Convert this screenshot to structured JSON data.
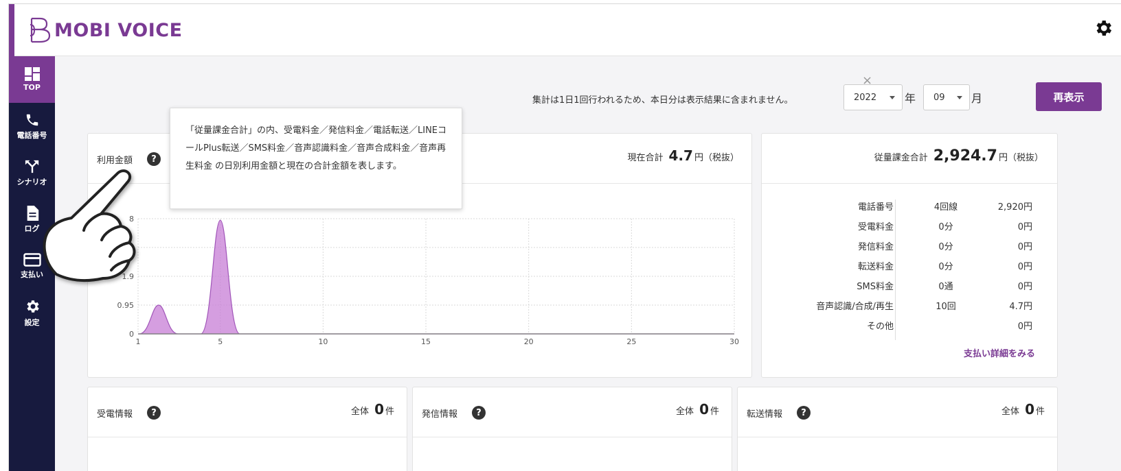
{
  "app": {
    "name": "MOBI VOICE"
  },
  "sidebar": {
    "items": [
      {
        "label": "TOP",
        "icon": "dashboard-icon",
        "active": true
      },
      {
        "label": "電話番号",
        "icon": "phone-icon"
      },
      {
        "label": "シナリオ",
        "icon": "scenario-branch-icon"
      },
      {
        "label": "ログ",
        "icon": "log-document-icon"
      },
      {
        "label": "支払い",
        "icon": "credit-card-icon"
      },
      {
        "label": "設定",
        "icon": "gear-icon"
      }
    ]
  },
  "header": {
    "close_glyph": "×",
    "notice": "集計は1日1回行われるため、本日分は表示結果に含まれません。",
    "year_value": "2022",
    "year_unit": "年",
    "month_value": "09",
    "month_unit": "月",
    "refresh_label": "再表示"
  },
  "usage_card": {
    "title": "利用金額",
    "help": "?",
    "total_label": "現在合計",
    "total_value": "4.7",
    "total_unit": "円（税抜）"
  },
  "tooltip": {
    "text": "「従量課金合計」の内、受電料金／発信料金／電話転送／LINEコールPlus転送／SMS料金／音声認識料金／音声合成料金／音声再生料金 の日別利用金額と現在の合計金額を表します。"
  },
  "metered_card": {
    "total_label": "従量課金合計",
    "total_value": "2,924.7",
    "total_unit": "円（税抜）",
    "rows": [
      {
        "label": "電話番号",
        "count": "4回線",
        "amount": "2,920円"
      },
      {
        "label": "受電料金",
        "count": "0分",
        "amount": "0円"
      },
      {
        "label": "発信料金",
        "count": "0分",
        "amount": "0円"
      },
      {
        "label": "転送料金",
        "count": "0分",
        "amount": "0円"
      },
      {
        "label": "SMS料金",
        "count": "0通",
        "amount": "0円"
      },
      {
        "label": "音声認識/合成/再生",
        "count": "10回",
        "amount": "4.7円"
      },
      {
        "label": "その他",
        "count": "",
        "amount": "0円"
      }
    ],
    "link": "支払い詳細をみる"
  },
  "stat_cards": [
    {
      "title": "受電情報",
      "help": "?",
      "total_label": "全体",
      "total_value": "0",
      "total_unit": "件"
    },
    {
      "title": "発信情報",
      "help": "?",
      "total_label": "全体",
      "total_value": "0",
      "total_unit": "件"
    },
    {
      "title": "転送情報",
      "help": "?",
      "total_label": "全体",
      "total_value": "0",
      "total_unit": "件"
    }
  ],
  "colors": {
    "brand": "#7a3a93",
    "sidebar": "#171a3e",
    "chart_fill": "#c77ed6"
  },
  "chart_data": {
    "type": "area",
    "x": [
      1,
      2,
      3,
      4,
      5,
      6,
      7,
      8,
      9,
      10,
      11,
      12,
      13,
      14,
      15,
      16,
      17,
      18,
      19,
      20,
      21,
      22,
      23,
      24,
      25,
      26,
      27,
      28,
      29,
      30
    ],
    "series": [
      {
        "values": [
          0,
          0.95,
          0,
          0,
          3.75,
          0,
          0,
          0,
          0,
          0,
          0,
          0,
          0,
          0,
          0,
          0,
          0,
          0,
          0,
          0,
          0,
          0,
          0,
          0,
          0,
          0,
          0,
          0,
          0,
          0
        ]
      }
    ],
    "xticks": [
      1,
      5,
      10,
      15,
      20,
      25,
      30
    ],
    "yticks": [
      {
        "value": 0,
        "label": "0"
      },
      {
        "value": 0.95,
        "label": "0.95"
      },
      {
        "value": 1.9,
        "label": "1.9"
      },
      {
        "value": 2.85,
        "label": "5"
      },
      {
        "value": 3.8,
        "label": "8"
      }
    ],
    "xlim": [
      1,
      30
    ],
    "ylim": [
      0,
      3.8
    ],
    "grid": true
  }
}
